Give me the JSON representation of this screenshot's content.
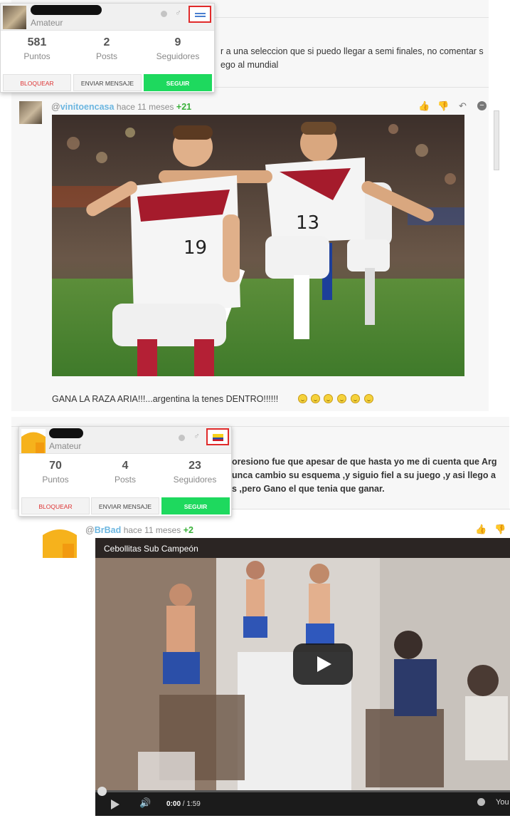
{
  "comment1": {
    "text_line1": "r a una seleccion que si puedo llegar a semi finales, no comentar s",
    "text_line2": "ego al mundial"
  },
  "card1": {
    "name": "",
    "rank": "Amateur",
    "stats": [
      {
        "value": "581",
        "label": "Puntos"
      },
      {
        "value": "2",
        "label": "Posts"
      },
      {
        "value": "9",
        "label": "Seguidores"
      }
    ],
    "buttons": {
      "block": "BLOQUEAR",
      "message": "ENVIAR MENSAJE",
      "follow": "SEGUIR"
    },
    "flag": "flag-icon"
  },
  "comment2": {
    "at": "@",
    "handle": "vinitoencasa",
    "time": "hace 11 meses",
    "votes": "+21",
    "text": "GANA LA RAZA ARIA!!!...argentina la tenes DENTRO!!!!!!"
  },
  "comment3": {
    "text_line1": "oresiono fue que apesar de que hasta yo me di cuenta que Arg",
    "text_line2": "unca cambio su esquema ,y siguio fiel a su juego ,y asi llego a",
    "text_line3": "s ,pero Gano el que tenia que ganar."
  },
  "card2": {
    "name": "",
    "rank": "Amateur",
    "stats": [
      {
        "value": "70",
        "label": "Puntos"
      },
      {
        "value": "4",
        "label": "Posts"
      },
      {
        "value": "23",
        "label": "Seguidores"
      }
    ],
    "buttons": {
      "block": "BLOQUEAR",
      "message": "ENVIAR MENSAJE",
      "follow": "SEGUIR"
    },
    "flag": "flag-icon"
  },
  "comment4": {
    "at": "@",
    "handle": "BrBad",
    "time": "hace 11 meses",
    "votes": "+2"
  },
  "video": {
    "title": "Cebollitas Sub Campeón",
    "current_time": "0:00",
    "duration": "/ 1:59",
    "brand": "You"
  },
  "colors": {
    "accent_follow": "#1ed95e",
    "handle": "#6cb6e0",
    "votes": "#38b038",
    "flag_highlight": "#e02b2b"
  }
}
